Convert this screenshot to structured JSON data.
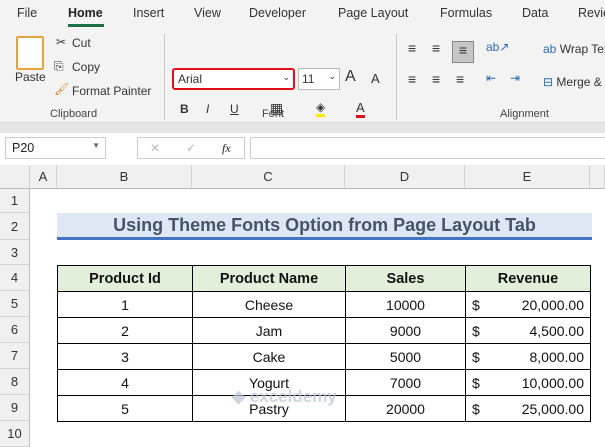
{
  "ribbon_tabs": [
    "File",
    "Home",
    "Insert",
    "View",
    "Developer",
    "Page Layout",
    "Formulas",
    "Data",
    "Revie"
  ],
  "clipboard": {
    "paste": "Paste",
    "cut": "Cut",
    "copy": "Copy",
    "format_painter": "Format Painter",
    "group": "Clipboard"
  },
  "font": {
    "name": "Arial",
    "size": "11",
    "group": "Font",
    "bold": "B",
    "italic": "I",
    "underline": "U",
    "grow": "A",
    "shrink": "A",
    "color": "A"
  },
  "alignment": {
    "wrap": "Wrap Tex",
    "merge": "Merge &",
    "group": "Alignment"
  },
  "formula_bar": {
    "name_box": "P20",
    "fx": "fx",
    "value": ""
  },
  "columns": [
    "A",
    "B",
    "C",
    "D",
    "E"
  ],
  "rows": [
    "1",
    "2",
    "3",
    "4",
    "5",
    "6",
    "7",
    "8",
    "9",
    "10"
  ],
  "title": "Using Theme Fonts Option from Page Layout Tab",
  "table": {
    "headers": [
      "Product Id",
      "Product Name",
      "Sales",
      "Revenue"
    ],
    "rows": [
      [
        "1",
        "Cheese",
        "10000",
        "$",
        "20,000.00"
      ],
      [
        "2",
        "Jam",
        "9000",
        "$",
        "4,500.00"
      ],
      [
        "3",
        "Cake",
        "5000",
        "$",
        "8,000.00"
      ],
      [
        "4",
        "Yogurt",
        "7000",
        "$",
        "10,000.00"
      ],
      [
        "5",
        "Pastry",
        "20000",
        "$",
        "25,000.00"
      ]
    ]
  },
  "watermark": "exceldemy"
}
